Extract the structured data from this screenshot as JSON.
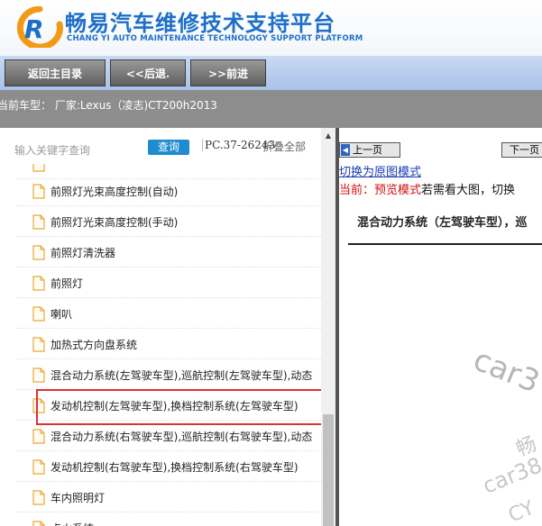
{
  "header": {
    "title_cn": "畅易汽车维修技术支持平台",
    "title_en": "CHANG YI AUTO MAINTENANCE TECHNOLOGY SUPPORT PLATFORM",
    "logo_icon": "cy-logo-icon"
  },
  "nav": {
    "home_label": "返回主目录",
    "back_label": "<<后退.",
    "forward_label": ">>前进"
  },
  "model_bar": {
    "text": "当前车型：  厂家:Lexus（凌志)CT200h2013"
  },
  "search": {
    "placeholder": "输入关键字查询",
    "button_label": "查询",
    "pc_code": "PC.37-26243",
    "collapse_all": "折叠全部"
  },
  "tree": {
    "items": [
      {
        "label": "前照灯光束高度控制(自动)"
      },
      {
        "label": "前照灯光束高度控制(手动)"
      },
      {
        "label": "前照灯清洗器"
      },
      {
        "label": "前照灯"
      },
      {
        "label": "喇叭"
      },
      {
        "label": "加热式方向盘系统"
      },
      {
        "label": "混合动力系统(左驾驶车型),巡航控制(左驾驶车型),动态"
      },
      {
        "label": "发动机控制(左驾驶车型),换档控制系统(左驾驶车型)",
        "selected": true
      },
      {
        "label": "混合动力系统(右驾驶车型),巡航控制(右驾驶车型),动态"
      },
      {
        "label": "发动机控制(右驾驶车型),换档控制系统(右驾驶车型)"
      },
      {
        "label": "车内照明灯"
      },
      {
        "label": "点火系统"
      }
    ]
  },
  "viewer": {
    "prev_label": "上一页",
    "next_label": "下一页",
    "switch_link": "切换为原图模式",
    "mode_current": "当前：预览模式",
    "mode_hint": "若需看大图，切换",
    "doc_title": "混合动力系统（左驾驶车型），巡",
    "watermarks": [
      "car3",
      "畅",
      "car38",
      "CY"
    ]
  },
  "colors": {
    "brand_blue": "#1c6fc9",
    "search_button": "#1e8ccf",
    "highlight_red": "#e03030",
    "mode_red": "#d01010",
    "model_bar_gray": "#8d8d8d"
  }
}
